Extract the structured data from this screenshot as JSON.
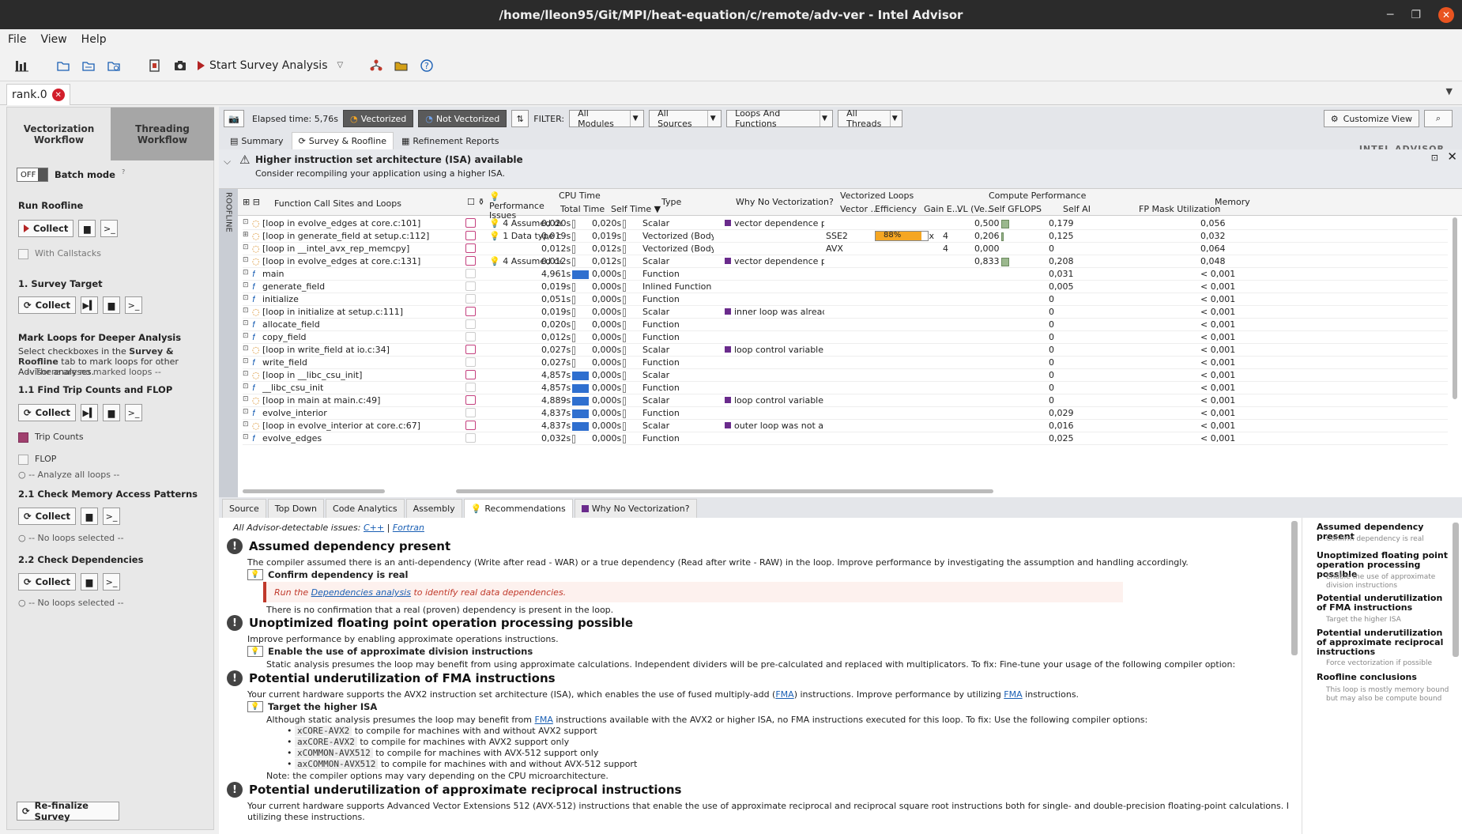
{
  "window": {
    "title": "/home/lleon95/Git/MPI/heat-equation/c/remote/adv-ver - Intel Advisor"
  },
  "menu": [
    "File",
    "View",
    "Help"
  ],
  "toolbar": {
    "start_label": "Start Survey Analysis"
  },
  "file_tab": {
    "label": "rank.0"
  },
  "left": {
    "vec_tab": "Vectorization Workflow",
    "thr_tab": "Threading Workflow",
    "batch_toggle": "OFF",
    "batch_label": "Batch mode",
    "run_roofline": "Run Roofline",
    "collect": "Collect",
    "with_callstacks": "With Callstacks",
    "survey_target": "1. Survey Target",
    "mark_loops": "Mark Loops for Deeper Analysis",
    "mark_help_pre": "Select checkboxes in the ",
    "mark_help_bold": "Survey & Roofline",
    "mark_help_post": " tab to mark loops for other Advisor analyses.",
    "no_marked": "-- There are no marked loops --",
    "trip_counts_title": "1.1 Find Trip Counts and FLOP",
    "trip_counts": "Trip Counts",
    "flop": "FLOP",
    "analyze_all": "-- Analyze all loops --",
    "mem_access": "2.1 Check Memory Access Patterns",
    "no_loops": "-- No loops selected --",
    "deps": "2.2 Check Dependencies",
    "no_loops2": "-- No loops selected --",
    "refinalize": "Re-finalize Survey"
  },
  "main_toolbar": {
    "elapsed": "Elapsed time: 5,76s",
    "vectorized": "Vectorized",
    "not_vectorized": "Not Vectorized",
    "filter": "FILTER:",
    "modules": "All Modules",
    "sources": "All Sources",
    "loops": "Loops And Functions",
    "threads": "All Threads",
    "customize": "Customize View"
  },
  "subtabs": [
    "Summary",
    "Survey & Roofline",
    "Refinement Reports"
  ],
  "brand": "INTEL ADVISOR",
  "isa": {
    "title": "Higher instruction set architecture (ISA) available",
    "text": "Consider recompiling your application using a higher ISA."
  },
  "roofline_side": "ROOFLINE",
  "grid_headers": {
    "calls": "Function Call Sites and Loops",
    "perf": "Performance Issues",
    "cpu": "CPU Time",
    "total": "Total Time",
    "self": "Self Time",
    "type": "Type",
    "why": "Why No Vectorization?",
    "vloops": "Vectorized Loops",
    "vector": "Vector ...",
    "eff": "Efficiency",
    "gain": "Gain E...",
    "vl": "VL (Ve...",
    "compute": "Compute Performance",
    "gflops": "Self GFLOPS",
    "ai": "Self AI",
    "fpmask": "FP Mask Utilization",
    "memory": "Memory"
  },
  "rows": [
    {
      "name": "[loop in evolve_edges at core.c:101]",
      "kind": "loop",
      "perf": "4 Assumed depen...",
      "total": "0,020s",
      "self": "0,020s",
      "type": "Scalar",
      "why": "vector dependence preve...",
      "vec": "",
      "eff": "",
      "gain": "",
      "vl": "",
      "gflops": "0,500",
      "ai": "0,179",
      "mem": "0,056",
      "chk": true,
      "bar": 0
    },
    {
      "name": "[loop in generate_field at setup.c:112]",
      "kind": "loop",
      "perf": "1 Data type conve...",
      "total": "0,019s",
      "self": "0,019s",
      "type": "Vectorized (Body; R...",
      "why": "",
      "vec": "SSE2",
      "eff": "88%",
      "effv": 0.88,
      "gain": "3,50x",
      "vl": "4",
      "gflops": "0,206",
      "ai": "0,125",
      "mem": "0,032",
      "chk": true,
      "bar": 0
    },
    {
      "name": "[loop in __intel_avx_rep_memcpy]",
      "kind": "loop",
      "perf": "",
      "total": "0,012s",
      "self": "0,012s",
      "type": "Vectorized (Body)",
      "why": "",
      "vec": "AVX",
      "eff": "",
      "gain": "",
      "vl": "4",
      "gflops": "0,000",
      "ai": "0",
      "mem": "0,064",
      "chk": true,
      "bar": 0
    },
    {
      "name": "[loop in evolve_edges at core.c:131]",
      "kind": "loop",
      "perf": "4 Assumed depen...",
      "total": "0,012s",
      "self": "0,012s",
      "type": "Scalar",
      "why": "vector dependence preve...",
      "vec": "",
      "eff": "",
      "gain": "",
      "vl": "",
      "gflops": "0,833",
      "ai": "0,208",
      "mem": "0,048",
      "chk": true,
      "bar": 0
    },
    {
      "name": "main",
      "kind": "func",
      "perf": "",
      "total": "4,961s",
      "self": "0,000s",
      "type": "Function",
      "why": "",
      "vec": "",
      "eff": "",
      "gain": "",
      "vl": "",
      "gflops": "",
      "ai": "0,031",
      "mem": "< 0,001",
      "chk": false,
      "bar": 1
    },
    {
      "name": "generate_field",
      "kind": "func",
      "perf": "",
      "total": "0,019s",
      "self": "0,000s",
      "type": "Inlined Function",
      "why": "",
      "vec": "",
      "eff": "",
      "gain": "",
      "vl": "",
      "gflops": "",
      "ai": "0,005",
      "mem": "< 0,001",
      "chk": false,
      "bar": 0
    },
    {
      "name": "initialize",
      "kind": "func",
      "perf": "",
      "total": "0,051s",
      "self": "0,000s",
      "type": "Function",
      "why": "",
      "vec": "",
      "eff": "",
      "gain": "",
      "vl": "",
      "gflops": "",
      "ai": "0",
      "mem": "< 0,001",
      "chk": false,
      "bar": 0
    },
    {
      "name": "[loop in initialize at setup.c:111]",
      "kind": "loop",
      "perf": "",
      "total": "0,019s",
      "self": "0,000s",
      "type": "Scalar",
      "why": "inner loop was already ve...",
      "vec": "",
      "eff": "",
      "gain": "",
      "vl": "",
      "gflops": "",
      "ai": "0",
      "mem": "< 0,001",
      "chk": true,
      "bar": 0
    },
    {
      "name": "allocate_field",
      "kind": "func",
      "perf": "",
      "total": "0,020s",
      "self": "0,000s",
      "type": "Function",
      "why": "",
      "vec": "",
      "eff": "",
      "gain": "",
      "vl": "",
      "gflops": "",
      "ai": "0",
      "mem": "< 0,001",
      "chk": false,
      "bar": 0
    },
    {
      "name": "copy_field",
      "kind": "func",
      "perf": "",
      "total": "0,012s",
      "self": "0,000s",
      "type": "Function",
      "why": "",
      "vec": "",
      "eff": "",
      "gain": "",
      "vl": "",
      "gflops": "",
      "ai": "0",
      "mem": "< 0,001",
      "chk": false,
      "bar": 0
    },
    {
      "name": "[loop in write_field at io.c:34]",
      "kind": "loop",
      "perf": "",
      "total": "0,027s",
      "self": "0,000s",
      "type": "Scalar",
      "why": "loop control variable was ...",
      "vec": "",
      "eff": "",
      "gain": "",
      "vl": "",
      "gflops": "",
      "ai": "0",
      "mem": "< 0,001",
      "chk": true,
      "bar": 0
    },
    {
      "name": "write_field",
      "kind": "func",
      "perf": "",
      "total": "0,027s",
      "self": "0,000s",
      "type": "Function",
      "why": "",
      "vec": "",
      "eff": "",
      "gain": "",
      "vl": "",
      "gflops": "",
      "ai": "0",
      "mem": "< 0,001",
      "chk": false,
      "bar": 0
    },
    {
      "name": "[loop in __libc_csu_init]",
      "kind": "loop",
      "perf": "",
      "total": "4,857s",
      "self": "0,000s",
      "type": "Scalar",
      "why": "",
      "vec": "",
      "eff": "",
      "gain": "",
      "vl": "",
      "gflops": "",
      "ai": "0",
      "mem": "< 0,001",
      "chk": true,
      "bar": 1
    },
    {
      "name": "__libc_csu_init",
      "kind": "func",
      "perf": "",
      "total": "4,857s",
      "self": "0,000s",
      "type": "Function",
      "why": "",
      "vec": "",
      "eff": "",
      "gain": "",
      "vl": "",
      "gflops": "",
      "ai": "0",
      "mem": "< 0,001",
      "chk": false,
      "bar": 1
    },
    {
      "name": "[loop in main at main.c:49]",
      "kind": "loop",
      "perf": "",
      "total": "4,889s",
      "self": "0,000s",
      "type": "Scalar",
      "why": "loop control variable was ...",
      "vec": "",
      "eff": "",
      "gain": "",
      "vl": "",
      "gflops": "",
      "ai": "0",
      "mem": "< 0,001",
      "chk": true,
      "bar": 1
    },
    {
      "name": "evolve_interior",
      "kind": "func",
      "perf": "",
      "total": "4,837s",
      "self": "0,000s",
      "type": "Function",
      "why": "",
      "vec": "",
      "eff": "",
      "gain": "",
      "vl": "",
      "gflops": "",
      "ai": "0,029",
      "mem": "< 0,001",
      "chk": false,
      "bar": 1
    },
    {
      "name": "[loop in evolve_interior at core.c:67]",
      "kind": "loop",
      "perf": "",
      "total": "4,837s",
      "self": "0,000s",
      "type": "Scalar",
      "why": "outer loop was not auto-v...",
      "vec": "",
      "eff": "",
      "gain": "",
      "vl": "",
      "gflops": "",
      "ai": "0,016",
      "mem": "< 0,001",
      "chk": true,
      "bar": 1
    },
    {
      "name": "evolve_edges",
      "kind": "func",
      "perf": "",
      "total": "0,032s",
      "self": "0,000s",
      "type": "Function",
      "why": "",
      "vec": "",
      "eff": "",
      "gain": "",
      "vl": "",
      "gflops": "",
      "ai": "0,025",
      "mem": "< 0,001",
      "chk": false,
      "bar": 0
    }
  ],
  "bottom_tabs": [
    "Source",
    "Top Down",
    "Code Analytics",
    "Assembly",
    "Recommendations",
    "Why No Vectorization?"
  ],
  "rec": {
    "all_issues": "All Advisor-detectable issues:",
    "cpp": "C++",
    "fortran": "Fortran",
    "i1_title": "Assumed dependency present",
    "i1_text": "The compiler assumed there is an anti-dependency (Write after read - WAR) or a true dependency (Read after write - RAW) in the loop. Improve performance by investigating the assumption and handling accordingly.",
    "i1_sub": "Confirm dependency is real",
    "i1_run_pre": "Run the ",
    "i1_run_link": "Dependencies analysis",
    "i1_run_post": " to identify real data dependencies.",
    "i1_note": "There is no confirmation that a real (proven) dependency is present in the loop.",
    "i2_title": "Unoptimized floating point operation processing possible",
    "i2_text": "Improve performance by enabling approximate operations instructions.",
    "i2_sub": "Enable the use of approximate division instructions",
    "i2_note": "Static analysis presumes the loop may benefit from using approximate calculations. Independent dividers will be pre-calculated and replaced with multiplicators. To fix: Fine-tune your usage of the following compiler option:",
    "i3_title": "Potential underutilization of FMA instructions",
    "i3_text_pre": "Your current hardware supports the AVX2 instruction set architecture (ISA), which enables the use of fused multiply-add (",
    "fma": "FMA",
    "i3_text_mid": ") instructions. Improve performance by utilizing ",
    "i3_text_post": " instructions.",
    "i3_sub": "Target the higher ISA",
    "i3_note_pre": "Although static analysis presumes the loop may benefit from ",
    "i3_note_post": " instructions available with the AVX2 or higher ISA, no FMA instructions executed for this loop. To fix: Use the following compiler options:",
    "opts": [
      {
        "code": "xCORE-AVX2",
        "text": " to compile for machines with and without AVX2 support"
      },
      {
        "code": "axCORE-AVX2",
        "text": " to compile for machines with AVX2 support only"
      },
      {
        "code": "xCOMMON-AVX512",
        "text": " to compile for machines with AVX-512 support only"
      },
      {
        "code": "axCOMMON-AVX512",
        "text": " to compile for machines with and without AVX-512 support"
      }
    ],
    "i3_foot": "Note: the compiler options may vary depending on the CPU microarchitecture.",
    "i4_title": "Potential underutilization of approximate reciprocal instructions",
    "i4_text": "Your current hardware supports Advanced Vector Extensions 512 (AVX-512) instructions that enable the use of approximate reciprocal and reciprocal square root instructions both for single- and double-precision floating-point calculations. Improve performance by",
    "i4_text2": "utilizing these instructions."
  },
  "sidebar": [
    {
      "h": "Assumed dependency present",
      "s": "Confirm dependency is real"
    },
    {
      "h": "Unoptimized floating point operation processing possible",
      "s": "Enable the use of approximate division instructions"
    },
    {
      "h": "Potential underutilization of FMA instructions",
      "s": "Target the higher ISA"
    },
    {
      "h": "Potential underutilization of approximate reciprocal instructions",
      "s": "Force vectorization if possible"
    },
    {
      "h": "Roofline conclusions",
      "s": "This loop is mostly memory bound but may also be compute bound"
    }
  ]
}
